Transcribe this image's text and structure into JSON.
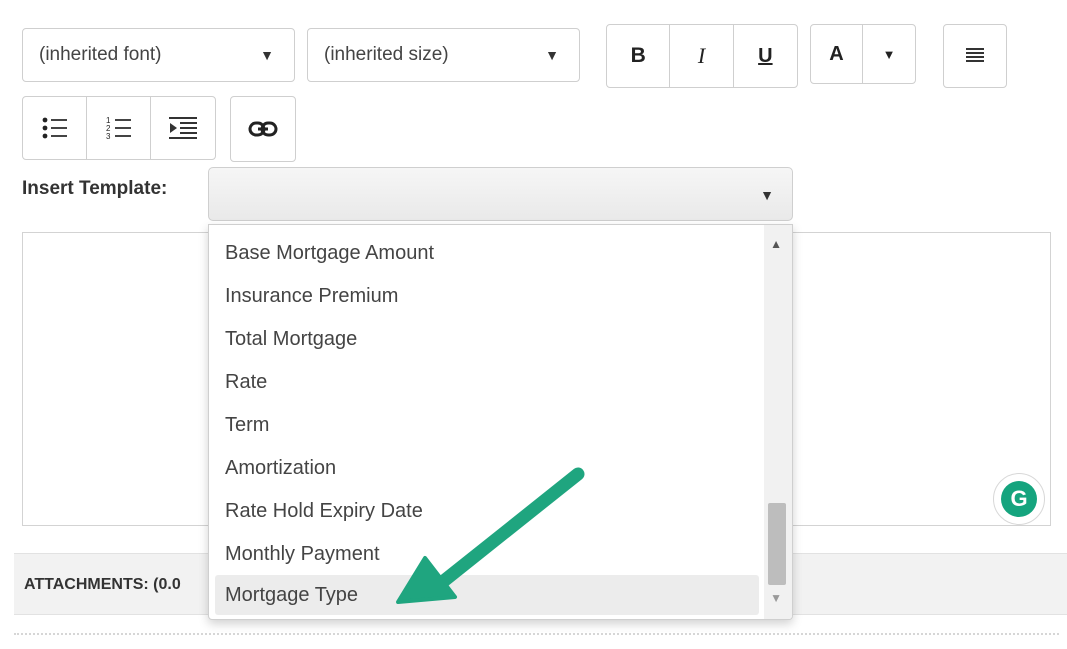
{
  "toolbar": {
    "font_select": "(inherited font)",
    "size_select": "(inherited size)",
    "bold": "B",
    "italic": "I",
    "underline": "U",
    "color": "A"
  },
  "insert_template": {
    "label": "Insert Template:",
    "selected": ""
  },
  "dropdown": {
    "options": [
      "Base Mortgage Amount",
      "Insurance Premium",
      "Total Mortgage",
      "Rate",
      "Term",
      "Amortization",
      "Rate Hold Expiry Date",
      "Monthly Payment",
      "Mortgage Type"
    ],
    "highlighted": "Mortgage Type"
  },
  "attachments": {
    "label": "ATTACHMENTS: (0.0"
  },
  "grammarly": {
    "glyph": "G"
  },
  "colors": {
    "annotation_arrow": "#1fa57f",
    "grammarly_badge": "#15a47e"
  },
  "icons": {
    "font_caret": "caret-down-icon",
    "bullets": "bulleted-list-icon",
    "numbers": "numbered-list-icon",
    "indent": "indent-icon",
    "link": "link-icon",
    "align": "justify-icon"
  }
}
